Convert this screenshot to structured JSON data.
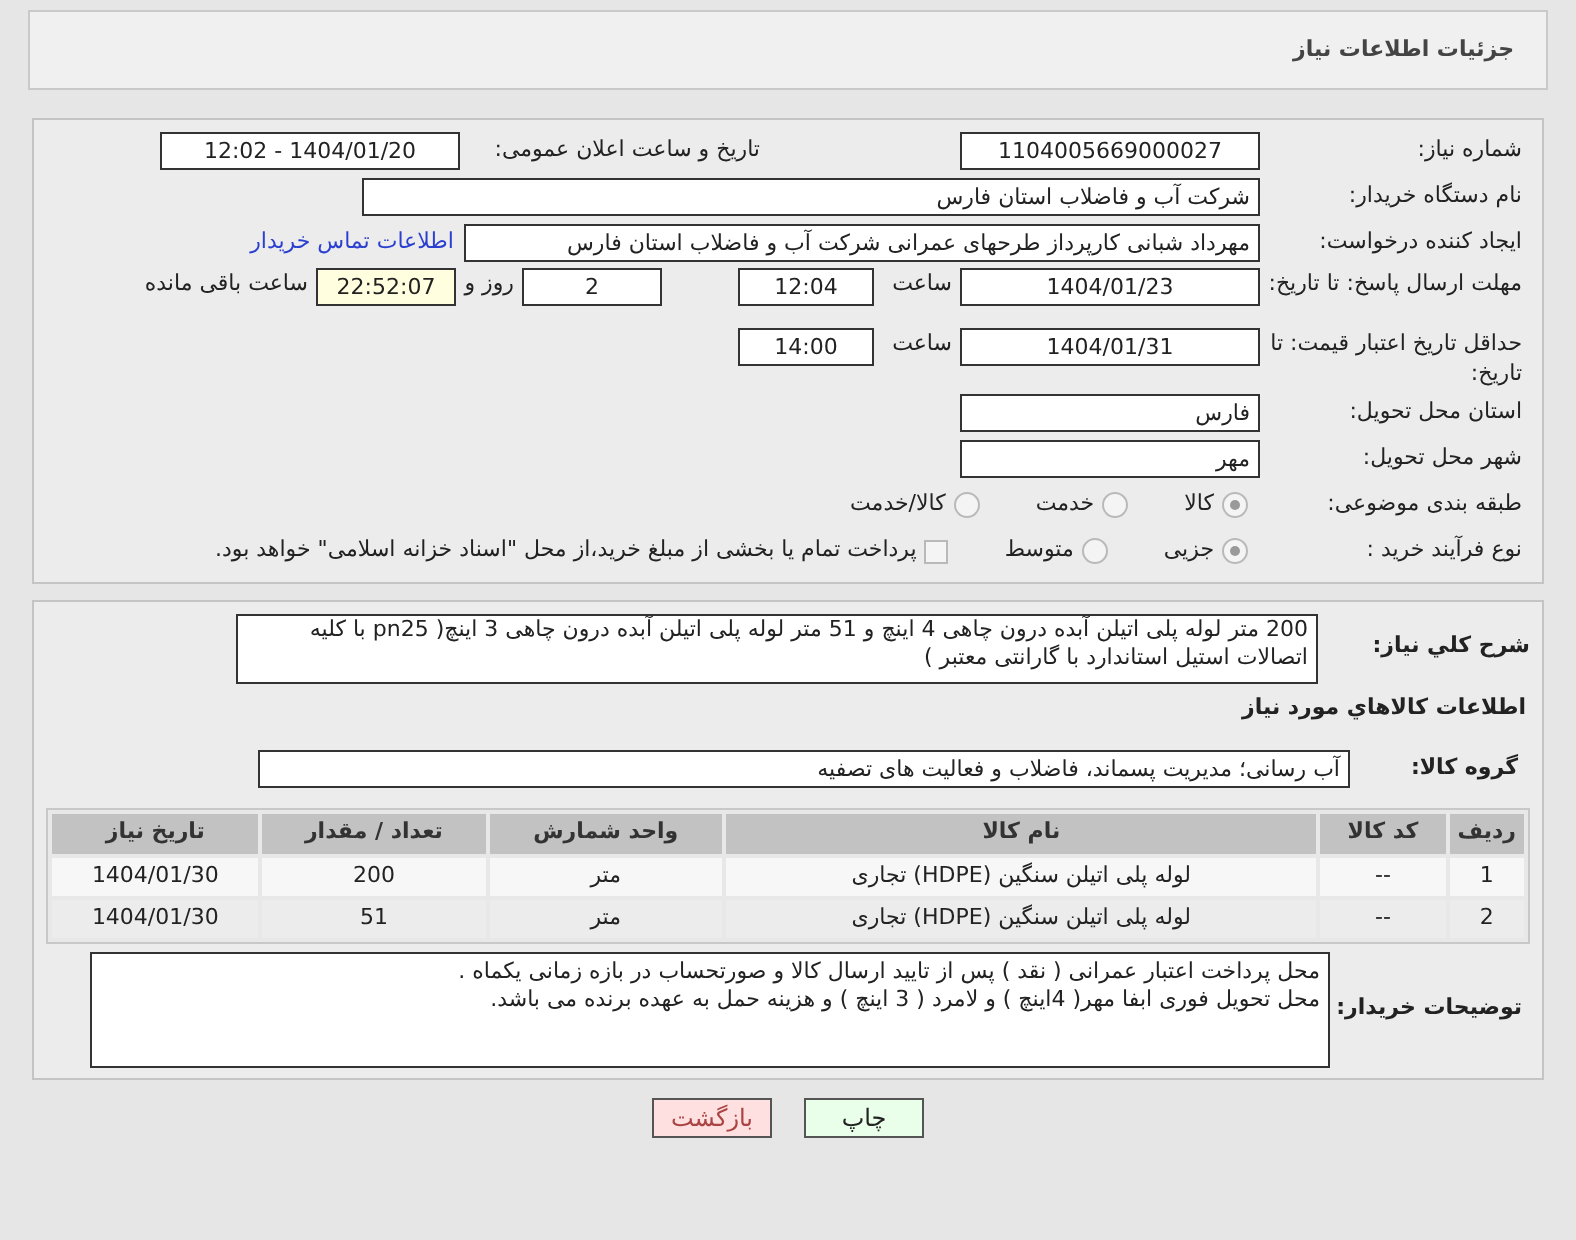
{
  "header": {
    "title": "جزئیات اطلاعات نیاز"
  },
  "need_number": {
    "label": "شماره نیاز:",
    "value": "1104005669000027"
  },
  "announce": {
    "label": "تاریخ و ساعت اعلان عمومی:",
    "value": "1404/01/20 - 12:02"
  },
  "buyer": {
    "label": "نام دستگاه خریدار:",
    "value": "شرکت آب و فاضلاب استان فارس"
  },
  "creator": {
    "label": "ایجاد کننده درخواست:",
    "value": "مهرداد شبانی کارپرداز طرحهای عمرانی  شرکت آب و فاضلاب استان فارس",
    "link": "اطلاعات تماس خریدار"
  },
  "deadline": {
    "label": "مهلت ارسال پاسخ: تا تاریخ:",
    "date": "1404/01/23",
    "time_label": "ساعت",
    "time": "12:04",
    "days": "2",
    "days_label": "روز و",
    "remaining": "22:52:07",
    "remaining_label": "ساعت باقی مانده"
  },
  "validity": {
    "label": "حداقل تاریخ اعتبار قیمت: تا تاریخ:",
    "date": "1404/01/31",
    "time_label": "ساعت",
    "time": "14:00"
  },
  "province": {
    "label": "استان محل تحویل:",
    "value": "فارس"
  },
  "city": {
    "label": "شهر محل تحویل:",
    "value": "مهر"
  },
  "category": {
    "label": "طبقه بندی موضوعی:",
    "options": [
      {
        "label": "کالا",
        "selected": true
      },
      {
        "label": "خدمت",
        "selected": false
      },
      {
        "label": "کالا/خدمت",
        "selected": false
      }
    ]
  },
  "process": {
    "label": "نوع فرآیند خرید :",
    "options": [
      {
        "label": "جزیی",
        "selected": true
      },
      {
        "label": "متوسط",
        "selected": false
      }
    ],
    "payment": {
      "label": "پرداخت تمام یا بخشی از مبلغ خرید،از محل \"اسناد خزانه اسلامی\" خواهد بود.",
      "checked": false
    }
  },
  "description": {
    "label": "شرح کلي نياز:",
    "value": "200 متر لوله پلی اتیلن آبده درون چاهی 4 اینچ و 51 متر لوله پلی اتیلن آبده درون چاهی 3 اینچ( pn25 با کلیه اتصالات استیل استاندارد با گارانتی معتبر )"
  },
  "goods_title": "اطلاعات کالاهاي مورد نياز",
  "group": {
    "label": "گروه کالا:",
    "value": "آب رسانی؛ مدیریت پسماند، فاضلاب و فعالیت های تصفیه"
  },
  "table": {
    "columns": [
      "ردیف",
      "کد کالا",
      "نام کالا",
      "واحد شمارش",
      "تعداد / مقدار",
      "تاریخ نیاز"
    ],
    "rows": [
      [
        "1",
        "--",
        "لوله پلی اتیلن سنگین (HDPE) تجاری",
        "متر",
        "200",
        "1404/01/30"
      ],
      [
        "2",
        "--",
        "لوله پلی اتیلن سنگین (HDPE) تجاری",
        "متر",
        "51",
        "1404/01/30"
      ]
    ]
  },
  "buyer_notes": {
    "label": "توضیحات خریدار:",
    "lines": [
      "محل پرداخت اعتبار عمرانی ( نقد ) پس از تایید ارسال کالا و صورتحساب در بازه زمانی یکماه .",
      "محل تحویل فوری ابفا مهر( 4اینچ ) و لامرد ( 3 اینچ ) و هزینه حمل به عهده برنده می باشد."
    ]
  },
  "buttons": [
    {
      "label": "چاپ",
      "kind": "print"
    },
    {
      "label": "بازگشت",
      "kind": "back"
    }
  ]
}
